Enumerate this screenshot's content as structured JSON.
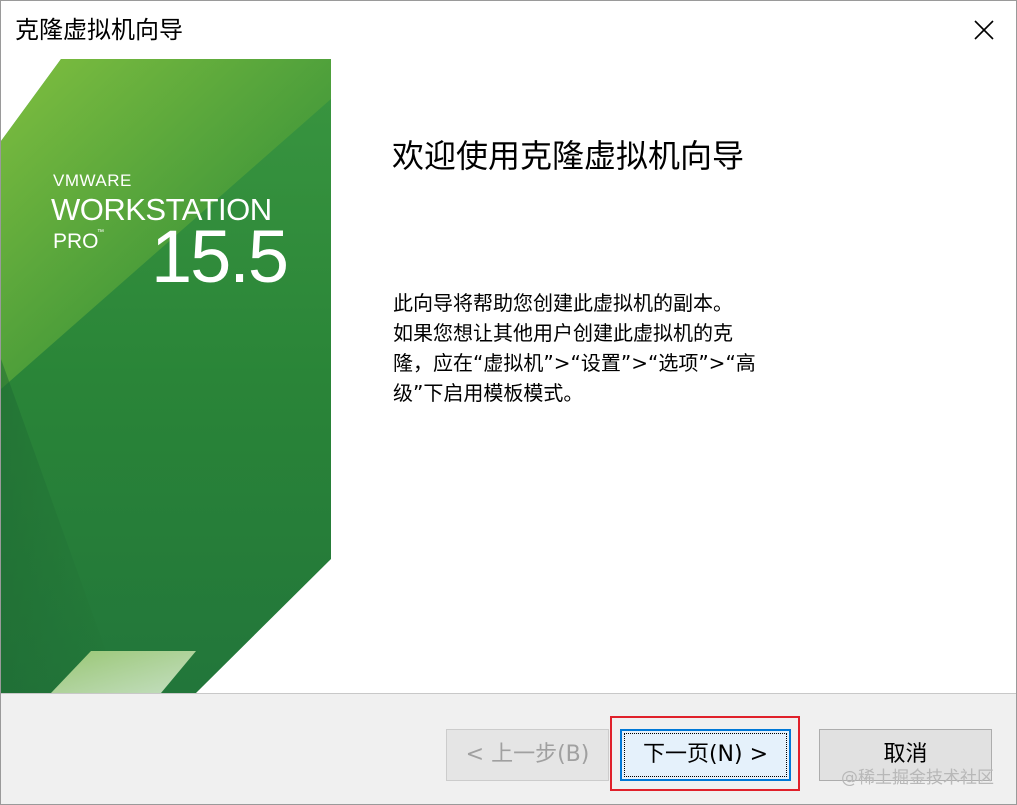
{
  "window": {
    "title": "克隆虚拟机向导"
  },
  "banner": {
    "vendor": "VMWARE",
    "product": "WORKSTATION",
    "edition": "PRO",
    "trademark": "™",
    "version": "15.5"
  },
  "content": {
    "heading": "欢迎使用克隆虚拟机向导",
    "description_lines": [
      "此向导将帮助您创建此虚拟机的副本。",
      "如果您想让其他用户创建此虚拟机的克",
      "隆，应在“虚拟机”>“设置”>“选项”>“高",
      "级”下启用模板模式。"
    ]
  },
  "buttons": {
    "back": "< 上一步(B)",
    "next": "下一页(N) >",
    "cancel": "取消"
  },
  "watermark": "@稀土掘金技术社区",
  "colors": {
    "banner_green": "#2f8a3c",
    "banner_light_green": "#7ab648",
    "focus_blue": "#0078d7",
    "highlight_red": "#e0202a"
  },
  "icons": {
    "close": "close-icon"
  }
}
